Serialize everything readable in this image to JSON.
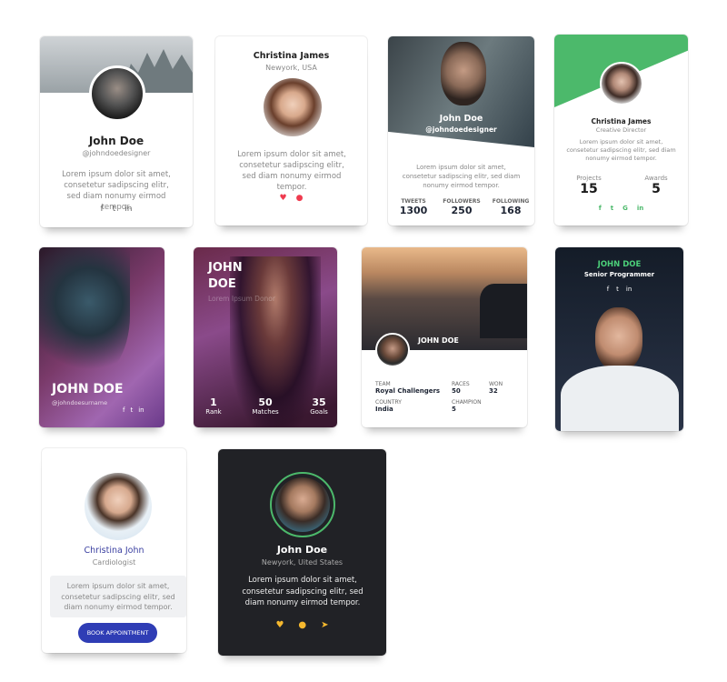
{
  "lorem": "Lorem ipsum dolor sit amet, consetetur sadipscing elitr, sed diam nonumy eirmod tempor.",
  "cards": [
    {
      "name": "John Doe",
      "handle": "@johndoedesigner",
      "social": [
        "f",
        "t",
        "in"
      ]
    },
    {
      "name": "Christina James",
      "location": "Newyork, USA",
      "icons": [
        "heart-icon",
        "comment-icon"
      ]
    },
    {
      "name": "John Doe",
      "handle": "@johndoedesigner",
      "stats": [
        {
          "label": "TWEETS",
          "value": "1300"
        },
        {
          "label": "FOLLOWERS",
          "value": "250"
        },
        {
          "label": "FOLLOWING",
          "value": "168"
        }
      ]
    },
    {
      "name": "Christina James",
      "role": "Creative Director",
      "stats": [
        {
          "label": "Projects",
          "value": "15"
        },
        {
          "label": "Awards",
          "value": "5"
        }
      ],
      "social": [
        "f",
        "t",
        "G",
        "in"
      ],
      "accent": "#4cb96b"
    },
    {
      "name": "JOHN DOE",
      "handle": "@johndoesurname",
      "social": [
        "f",
        "t",
        "in"
      ]
    },
    {
      "name_line1": "JOHN",
      "name_line2": "DOE",
      "tagline": "Lorem Ipsum Donor",
      "stats": [
        {
          "label": "Rank",
          "value": "1"
        },
        {
          "label": "Matches",
          "value": "50"
        },
        {
          "label": "Goals",
          "value": "35"
        }
      ]
    },
    {
      "name": "JOHN DOE",
      "fields": [
        {
          "label": "TEAM",
          "value": "Royal Challengers"
        },
        {
          "label": "RACES",
          "value": "50"
        },
        {
          "label": "WON",
          "value": "32"
        },
        {
          "label": "COUNTRY",
          "value": "India"
        },
        {
          "label": "CHAMPION",
          "value": "5"
        }
      ]
    },
    {
      "name": "JOHN DOE",
      "role": "Senior Programmer",
      "social": [
        "f",
        "t",
        "in"
      ],
      "accent": "#4cd07a"
    },
    {
      "name": "Christina John",
      "role": "Cardiologist",
      "button": "BOOK APPOINTMENT",
      "accent": "#2f3db5"
    },
    {
      "name": "John Doe",
      "location": "Newyork, Uited States",
      "icons": [
        "heart-icon",
        "comment-icon",
        "send-icon"
      ],
      "accent": "#f5b82e"
    }
  ]
}
